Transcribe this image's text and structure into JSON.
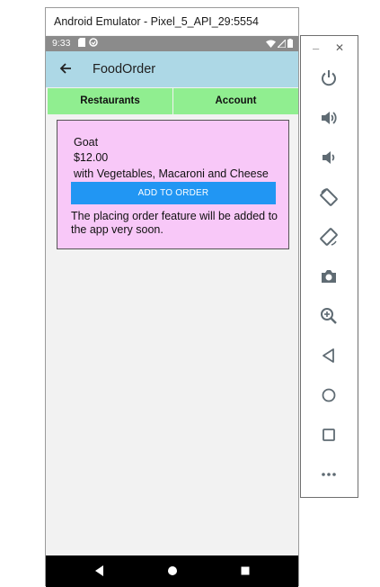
{
  "window": {
    "title": "Android Emulator - Pixel_5_API_29:5554"
  },
  "status_bar": {
    "time": "9:33"
  },
  "app_bar": {
    "title": "FoodOrder",
    "back_icon": "arrow-back-icon"
  },
  "tabs": [
    {
      "label": "Restaurants"
    },
    {
      "label": "Account"
    }
  ],
  "card": {
    "name": "Goat",
    "price": "$12.00",
    "description": "with Vegetables, Macaroni and Cheese",
    "button_label": "ADD TO ORDER",
    "note": "The placing order  feature will be added to the app very soon."
  },
  "toolbar": {
    "minimize": "–",
    "close": "✕",
    "items": [
      "power-icon",
      "volume-up-icon",
      "volume-down-icon",
      "rotate-left-icon",
      "rotate-right-icon",
      "camera-icon",
      "zoom-icon",
      "back-icon",
      "home-icon",
      "overview-icon",
      "more-icon"
    ]
  },
  "colors": {
    "app_bar": "#add8e6",
    "tabs": "#90ee90",
    "card": "#f8c8f8",
    "button": "#2196f3",
    "status_bar": "#8b8b8b"
  }
}
